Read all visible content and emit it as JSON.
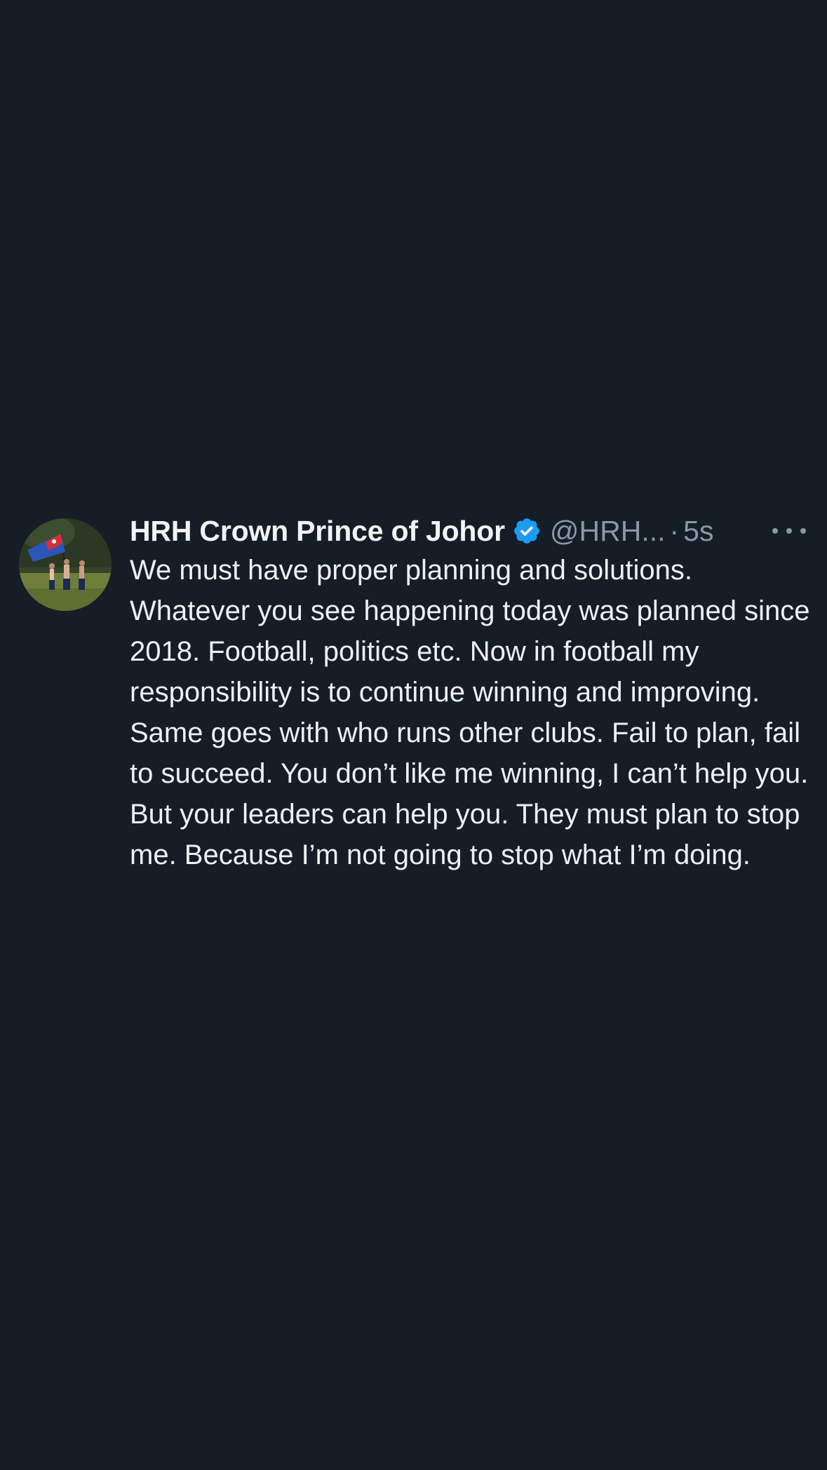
{
  "tweet": {
    "display_name": "HRH Crown Prince of Johor",
    "handle": "@HRH...",
    "separator": "·",
    "time": "5s",
    "text": "We must have proper planning and solutions. Whatever you see happening today was planned since 2018. Football, politics etc. Now in football my responsibility is to continue winning and improving. Same goes with who runs other clubs. Fail to plan, fail to succeed. You don’t like me winning, I can’t help you. But your leaders can help you. They must plan to stop me. Because I’m not going to stop what I’m doing.",
    "verified_icon": "verified-badge-icon",
    "more_icon": "more-options-icon"
  },
  "colors": {
    "background": "#151d27",
    "name": "#f1f3f5",
    "secondary": "#8b98a5",
    "verified": "#1d9bf0",
    "text": "#eef1f4"
  }
}
